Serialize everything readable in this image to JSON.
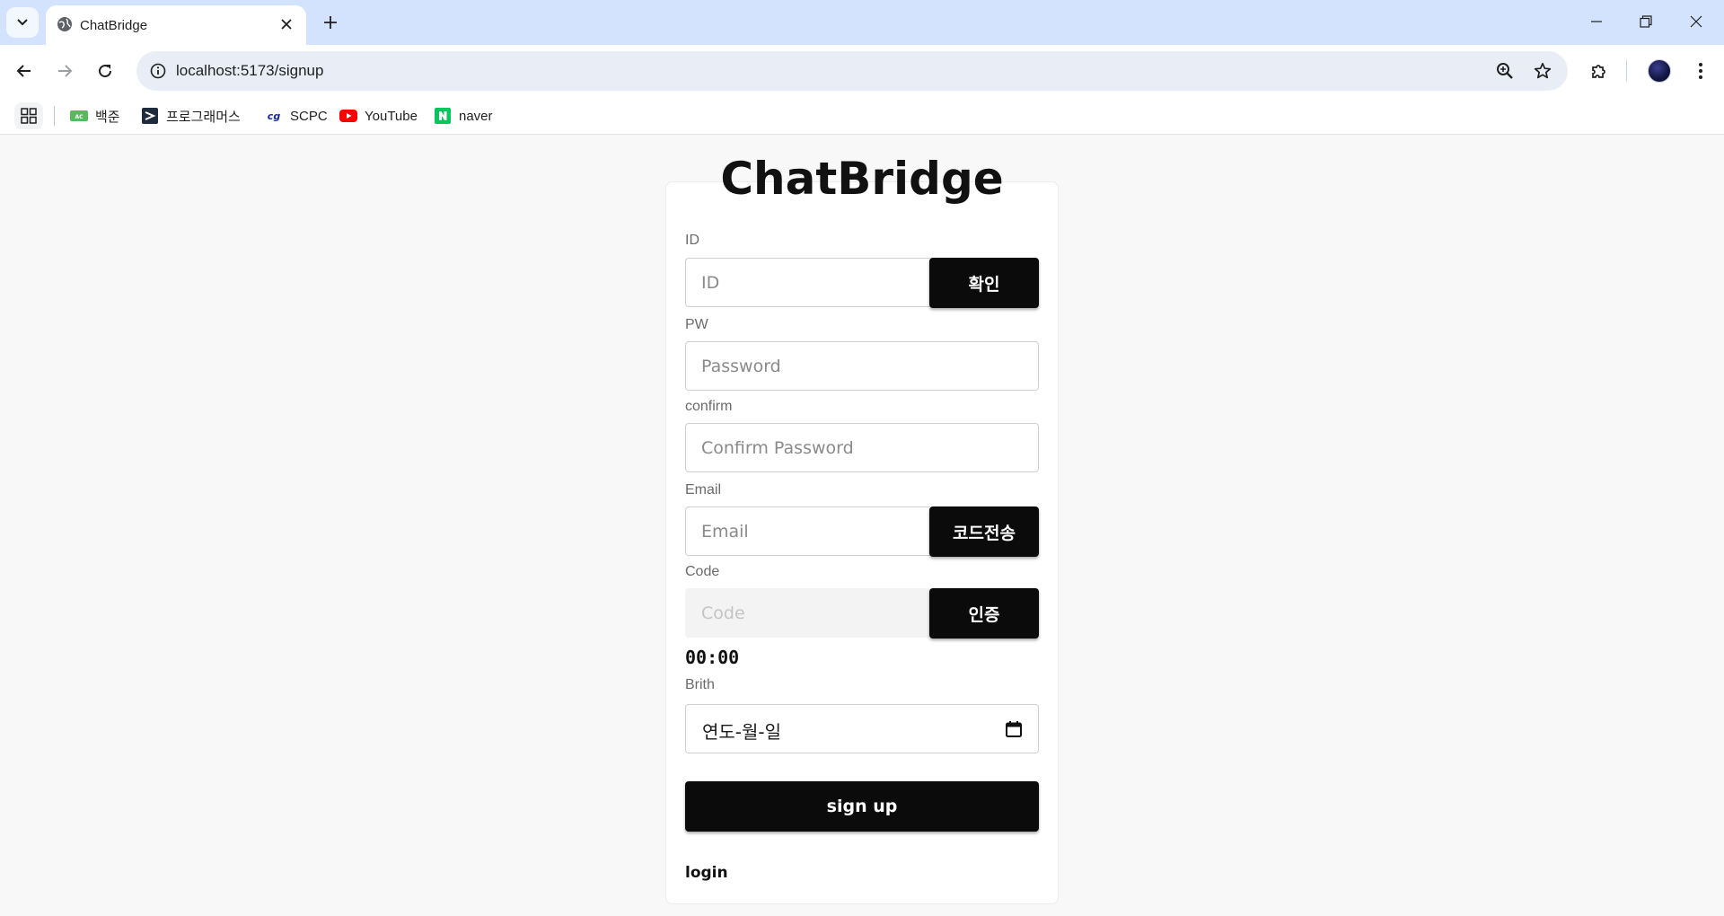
{
  "browser": {
    "tab": {
      "title": "ChatBridge",
      "icon": "globe-icon"
    },
    "omnibox": {
      "url": "localhost:5173/signup"
    },
    "bookmarks": [
      {
        "label": "백준",
        "icon": "acmicpc-icon",
        "color": "#5cb85c"
      },
      {
        "label": "프로그래머스",
        "icon": "programmers-icon",
        "color": "#1e2b3c"
      },
      {
        "label": "SCPC",
        "icon": "scpc-icon",
        "color": "#1428a0"
      },
      {
        "label": "YouTube",
        "icon": "youtube-icon",
        "color": "#ff0000"
      },
      {
        "label": "naver",
        "icon": "naver-icon",
        "color": "#03c75a"
      }
    ]
  },
  "page": {
    "title": "ChatBridge",
    "id": {
      "label": "ID",
      "placeholder": "ID",
      "button": "확인"
    },
    "pw": {
      "label": "PW",
      "placeholder": "Password"
    },
    "confirm": {
      "label": "confirm",
      "placeholder": "Confirm Password"
    },
    "email": {
      "label": "Email",
      "placeholder": "Email",
      "button": "코드전송"
    },
    "code": {
      "label": "Code",
      "placeholder": "Code",
      "button": "인증"
    },
    "timer": "00:00",
    "birth": {
      "label": "Brith",
      "value": "연도-월-일"
    },
    "submit": "sign up",
    "login": "login"
  },
  "colors": {
    "button_bg": "#0b0b0b",
    "page_bg": "#f8f8f8",
    "tabstrip_bg": "#d3e3fd"
  }
}
